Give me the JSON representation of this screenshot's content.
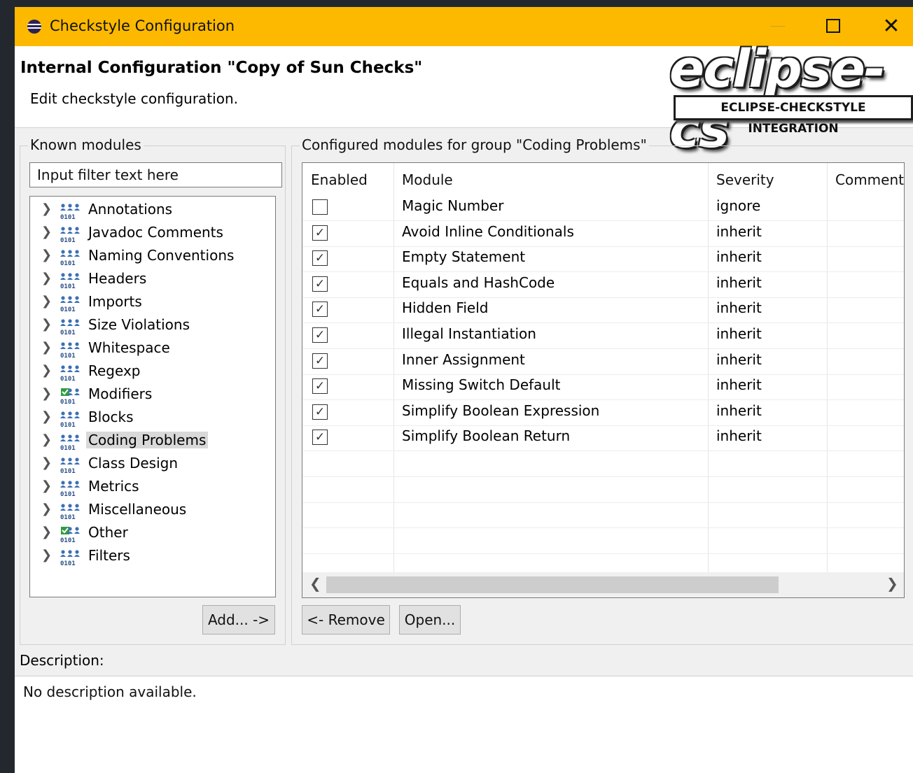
{
  "window": {
    "title": "Checkstyle Configuration",
    "icon": "eclipse-icon",
    "controls": {
      "minimize": "minimize",
      "maximize": "maximize",
      "close": "✕"
    }
  },
  "header": {
    "title": "Internal Configuration \"Copy of Sun Checks\"",
    "subtitle": "Edit checkstyle configuration.",
    "logo_word": "eclipse-cs",
    "logo_tagline": "ECLIPSE-CHECKSTYLE INTEGRATION"
  },
  "known_modules": {
    "label": "Known modules",
    "filter_placeholder": "Input filter text here",
    "selected": "Coding Problems",
    "items": [
      {
        "label": "Annotations",
        "icon": "module-group-icon",
        "has_configured": false
      },
      {
        "label": "Javadoc Comments",
        "icon": "module-group-icon",
        "has_configured": false
      },
      {
        "label": "Naming Conventions",
        "icon": "module-group-icon",
        "has_configured": false
      },
      {
        "label": "Headers",
        "icon": "module-group-icon",
        "has_configured": false
      },
      {
        "label": "Imports",
        "icon": "module-group-icon",
        "has_configured": false
      },
      {
        "label": "Size Violations",
        "icon": "module-group-icon",
        "has_configured": false
      },
      {
        "label": "Whitespace",
        "icon": "module-group-icon",
        "has_configured": false
      },
      {
        "label": "Regexp",
        "icon": "module-group-icon",
        "has_configured": false
      },
      {
        "label": "Modifiers",
        "icon": "module-group-checked-icon",
        "has_configured": true
      },
      {
        "label": "Blocks",
        "icon": "module-group-icon",
        "has_configured": false
      },
      {
        "label": "Coding Problems",
        "icon": "module-group-icon",
        "has_configured": false
      },
      {
        "label": "Class Design",
        "icon": "module-group-icon",
        "has_configured": false
      },
      {
        "label": "Metrics",
        "icon": "module-group-icon",
        "has_configured": false
      },
      {
        "label": "Miscellaneous",
        "icon": "module-group-icon",
        "has_configured": false
      },
      {
        "label": "Other",
        "icon": "module-group-checked-icon",
        "has_configured": true
      },
      {
        "label": "Filters",
        "icon": "module-group-icon",
        "has_configured": false
      }
    ],
    "add_button": "Add... ->"
  },
  "configured": {
    "label": "Configured modules for group \"Coding Problems\"",
    "columns": [
      "Enabled",
      "Module",
      "Severity",
      "Comment"
    ],
    "rows": [
      {
        "enabled": false,
        "module": "Magic Number",
        "severity": "ignore",
        "comment": ""
      },
      {
        "enabled": true,
        "module": "Avoid Inline Conditionals",
        "severity": "inherit",
        "comment": ""
      },
      {
        "enabled": true,
        "module": "Empty Statement",
        "severity": "inherit",
        "comment": ""
      },
      {
        "enabled": true,
        "module": "Equals and HashCode",
        "severity": "inherit",
        "comment": ""
      },
      {
        "enabled": true,
        "module": "Hidden Field",
        "severity": "inherit",
        "comment": ""
      },
      {
        "enabled": true,
        "module": "Illegal Instantiation",
        "severity": "inherit",
        "comment": ""
      },
      {
        "enabled": true,
        "module": "Inner Assignment",
        "severity": "inherit",
        "comment": ""
      },
      {
        "enabled": true,
        "module": "Missing Switch Default",
        "severity": "inherit",
        "comment": ""
      },
      {
        "enabled": true,
        "module": "Simplify Boolean Expression",
        "severity": "inherit",
        "comment": ""
      },
      {
        "enabled": true,
        "module": "Simplify Boolean Return",
        "severity": "inherit",
        "comment": ""
      }
    ],
    "remove_button": "<- Remove",
    "open_button": "Open..."
  },
  "description": {
    "label": "Description:",
    "text": "No description available."
  },
  "colors": {
    "titlebar": "#fdb900",
    "selection": "#d9d9d9",
    "dialog_bg": "#f0f0f0"
  }
}
